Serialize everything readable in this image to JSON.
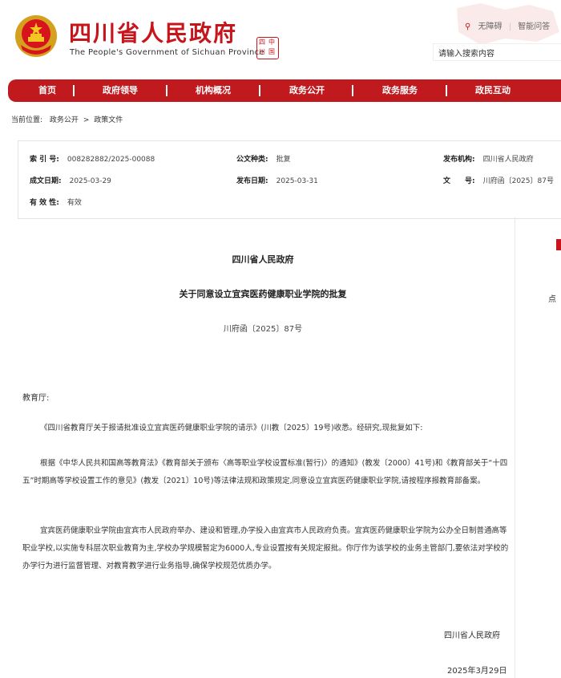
{
  "header": {
    "site_name": "四川省人民政府",
    "site_name_en": "The People's Government of Sichuan Province",
    "top_links": [
      "无障碍",
      "智能问答"
    ],
    "search_placeholder": "请输入搜索内容",
    "colors": {
      "brand_red": "#c8141b",
      "nav_red": "#c01a1f"
    }
  },
  "nav": {
    "items": [
      "首页",
      "政府领导",
      "机构概况",
      "政务公开",
      "政务服务",
      "政民互动"
    ]
  },
  "breadcrumb": {
    "prefix": "当前位置:",
    "items": [
      "政务公开",
      "政策文件"
    ],
    "separator": ">"
  },
  "meta": {
    "index_label": "索 引 号:",
    "index_value": "008282882/2025-00088",
    "category_label": "公文种类:",
    "category_value": "批复",
    "publisher_label": "发布机构:",
    "publisher_value": "四川省人民政府",
    "created_label": "成文日期:",
    "created_value": "2025-03-29",
    "published_label": "发布日期:",
    "published_value": "2025-03-31",
    "docno_label": "文　　号:",
    "docno_value": "川府函〔2025〕87号",
    "validity_label": "有 效 性:",
    "validity_value": "有效"
  },
  "document": {
    "org": "四川省人民政府",
    "title": "关于同意设立宜宾医药健康职业学院的批复",
    "number": "川府函〔2025〕87号",
    "salutation": "教育厅:",
    "paragraphs": [
      "《四川省教育厅关于报请批准设立宜宾医药健康职业学院的请示》(川教〔2025〕19号)收悉。经研究,现批复如下:",
      "根据《中华人民共和国高等教育法》《教育部关于颁布〈高等职业学校设置标准(暂行)〉的通知》(教发〔2000〕41号)和《教育部关于“十四五”时期高等学校设置工作的意见》(教发〔2021〕10号)等法律法规和政策规定,同意设立宜宾医药健康职业学院,请按程序报教育部备案。",
      "宜宾医药健康职业学院由宜宾市人民政府举办、建设和管理,办学投入由宜宾市人民政府负责。宜宾医药健康职业学院为公办全日制普通高等职业学校,以实施专科层次职业教育为主,学校办学规模暂定为6000人,专业设置按有关规定报批。你厅作为该学校的业务主管部门,要依法对学校的办学行为进行监督管理、对教育教学进行业务指导,确保学校规范优质办学。"
    ],
    "signature_org": "四川省人民政府",
    "signature_date": "2025年3月29日"
  },
  "side": {
    "text": "点"
  }
}
